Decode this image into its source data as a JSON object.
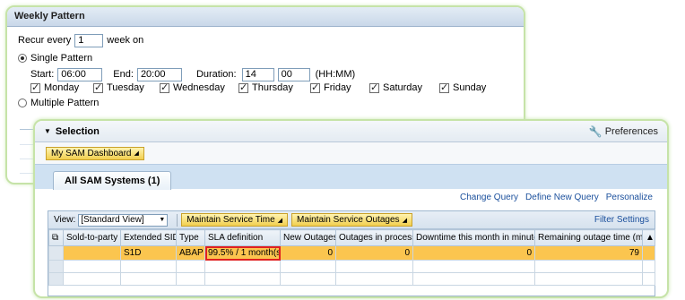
{
  "weekly": {
    "title": "Weekly Pattern",
    "recur_prefix": "Recur every",
    "recur_value": "1",
    "recur_suffix": "week on",
    "single_label": "Single Pattern",
    "start_label": "Start:",
    "start_value": "06:00",
    "end_label": "End:",
    "end_value": "20:00",
    "duration_label": "Duration:",
    "duration_h": "14",
    "duration_m": "00",
    "duration_unit": "(HH:MM)",
    "days": [
      "Monday",
      "Tuesday",
      "Wednesday",
      "Thursday",
      "Friday",
      "Saturday",
      "Sunday"
    ],
    "multiple_label": "Multiple Pattern"
  },
  "selection": {
    "title": "Selection",
    "preferences": "Preferences",
    "dashboard_btn": "My SAM Dashboard",
    "tab": "All SAM Systems (1)",
    "links": [
      "Change Query",
      "Define New Query",
      "Personalize"
    ],
    "view_label": "View:",
    "view_value": "[Standard View]",
    "btn_service_time": "Maintain Service Time",
    "btn_service_outages": "Maintain Service Outages",
    "filter_settings": "Filter Settings"
  },
  "table": {
    "columns": [
      "Sold-to-party",
      "Extended SID",
      "Type",
      "SLA definition",
      "New Outages",
      "Outages in process",
      "Downtime this month in minutes",
      "Remaining outage time (min.)"
    ],
    "row": {
      "sold_to": "",
      "sid": "S1D",
      "type": "ABAP",
      "sla": "99.5% / 1 month(s)",
      "new_outages": "0",
      "in_process": "0",
      "downtime": "0",
      "remaining": "79"
    }
  }
}
